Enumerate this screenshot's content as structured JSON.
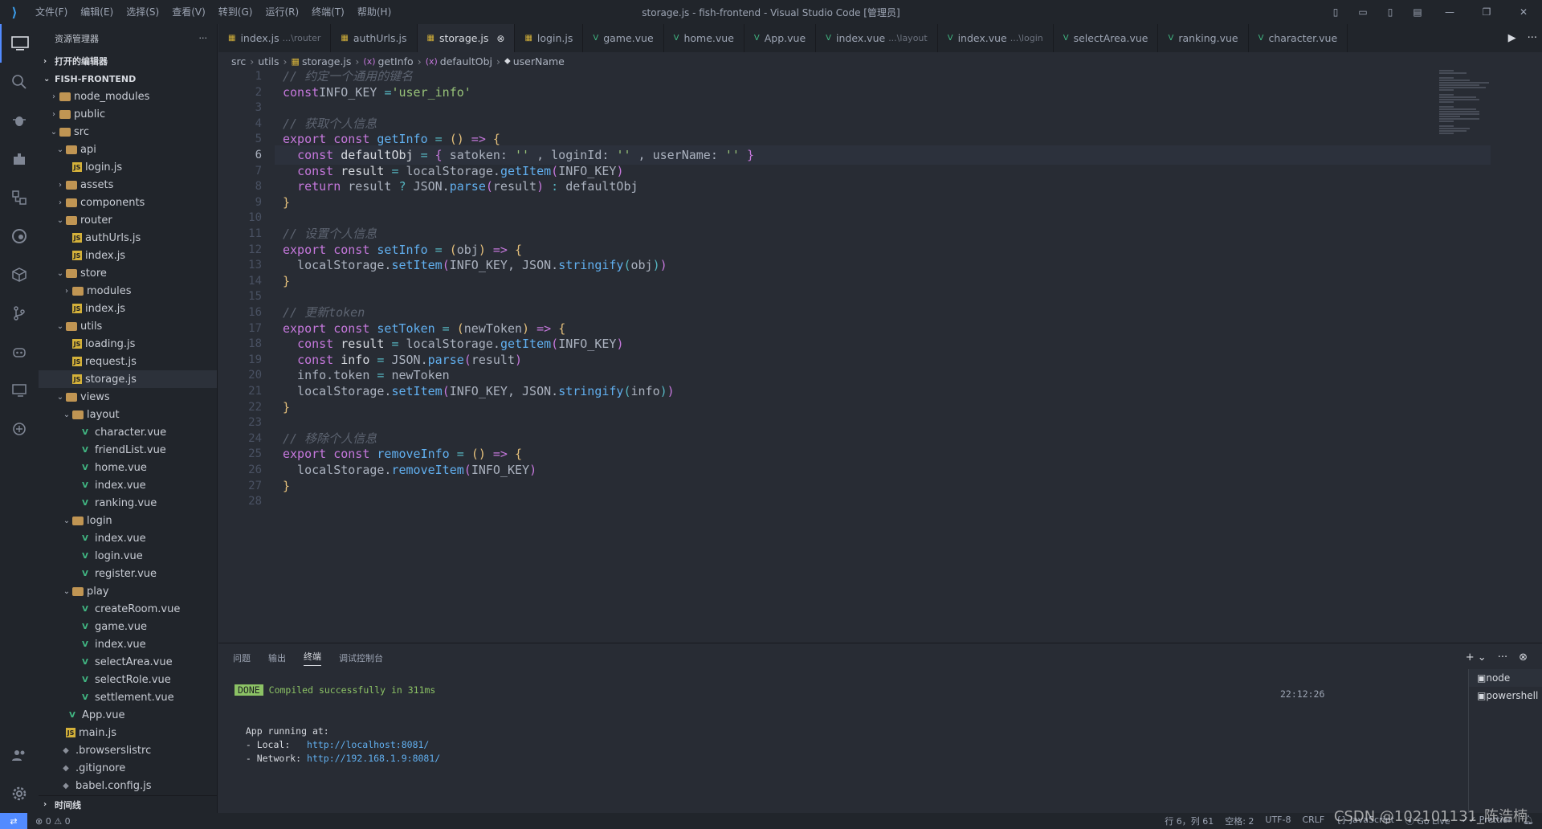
{
  "window": {
    "title": "storage.js - fish-frontend - Visual Studio Code [管理员]",
    "menu": [
      "文件(F)",
      "编辑(E)",
      "选择(S)",
      "查看(V)",
      "转到(G)",
      "运行(R)",
      "终端(T)",
      "帮助(H)"
    ]
  },
  "sidebar": {
    "title": "资源管理器",
    "open_editors": "打开的编辑器",
    "project": "FISH-FRONTEND",
    "timeline": "时间线",
    "tree": [
      {
        "depth": 1,
        "chev": "›",
        "icon": "folder",
        "label": "node_modules"
      },
      {
        "depth": 1,
        "chev": "›",
        "icon": "folder",
        "label": "public"
      },
      {
        "depth": 1,
        "chev": "⌄",
        "icon": "folder",
        "label": "src"
      },
      {
        "depth": 2,
        "chev": "⌄",
        "icon": "folder",
        "label": "api"
      },
      {
        "depth": 3,
        "chev": "",
        "icon": "js",
        "label": "login.js"
      },
      {
        "depth": 2,
        "chev": "›",
        "icon": "folder",
        "label": "assets"
      },
      {
        "depth": 2,
        "chev": "›",
        "icon": "folder",
        "label": "components"
      },
      {
        "depth": 2,
        "chev": "⌄",
        "icon": "folder",
        "label": "router"
      },
      {
        "depth": 3,
        "chev": "",
        "icon": "js",
        "label": "authUrls.js"
      },
      {
        "depth": 3,
        "chev": "",
        "icon": "js",
        "label": "index.js"
      },
      {
        "depth": 2,
        "chev": "⌄",
        "icon": "folder",
        "label": "store"
      },
      {
        "depth": 3,
        "chev": "›",
        "icon": "folder",
        "label": "modules"
      },
      {
        "depth": 3,
        "chev": "",
        "icon": "js",
        "label": "index.js"
      },
      {
        "depth": 2,
        "chev": "⌄",
        "icon": "folder",
        "label": "utils"
      },
      {
        "depth": 3,
        "chev": "",
        "icon": "js",
        "label": "loading.js"
      },
      {
        "depth": 3,
        "chev": "",
        "icon": "js",
        "label": "request.js"
      },
      {
        "depth": 3,
        "chev": "",
        "icon": "js",
        "label": "storage.js",
        "selected": true
      },
      {
        "depth": 2,
        "chev": "⌄",
        "icon": "folder",
        "label": "views"
      },
      {
        "depth": 3,
        "chev": "⌄",
        "icon": "folder",
        "label": "layout"
      },
      {
        "depth": 4,
        "chev": "",
        "icon": "vue",
        "label": "character.vue"
      },
      {
        "depth": 4,
        "chev": "",
        "icon": "vue",
        "label": "friendList.vue"
      },
      {
        "depth": 4,
        "chev": "",
        "icon": "vue",
        "label": "home.vue"
      },
      {
        "depth": 4,
        "chev": "",
        "icon": "vue",
        "label": "index.vue"
      },
      {
        "depth": 4,
        "chev": "",
        "icon": "vue",
        "label": "ranking.vue"
      },
      {
        "depth": 3,
        "chev": "⌄",
        "icon": "folder",
        "label": "login"
      },
      {
        "depth": 4,
        "chev": "",
        "icon": "vue",
        "label": "index.vue"
      },
      {
        "depth": 4,
        "chev": "",
        "icon": "vue",
        "label": "login.vue"
      },
      {
        "depth": 4,
        "chev": "",
        "icon": "vue",
        "label": "register.vue"
      },
      {
        "depth": 3,
        "chev": "⌄",
        "icon": "folder",
        "label": "play"
      },
      {
        "depth": 4,
        "chev": "",
        "icon": "vue",
        "label": "createRoom.vue"
      },
      {
        "depth": 4,
        "chev": "",
        "icon": "vue",
        "label": "game.vue"
      },
      {
        "depth": 4,
        "chev": "",
        "icon": "vue",
        "label": "index.vue"
      },
      {
        "depth": 4,
        "chev": "",
        "icon": "vue",
        "label": "selectArea.vue"
      },
      {
        "depth": 4,
        "chev": "",
        "icon": "vue",
        "label": "selectRole.vue"
      },
      {
        "depth": 4,
        "chev": "",
        "icon": "vue",
        "label": "settlement.vue"
      },
      {
        "depth": 2,
        "chev": "",
        "icon": "vue",
        "label": "App.vue"
      },
      {
        "depth": 2,
        "chev": "",
        "icon": "js",
        "label": "main.js"
      },
      {
        "depth": 1,
        "chev": "",
        "icon": "file",
        "label": ".browserslistrc"
      },
      {
        "depth": 1,
        "chev": "",
        "icon": "file",
        "label": ".gitignore"
      },
      {
        "depth": 1,
        "chev": "",
        "icon": "file",
        "label": "babel.config.js"
      }
    ]
  },
  "tabs": [
    {
      "label": "index.js",
      "hint": "...\\router",
      "icon": "js"
    },
    {
      "label": "authUrls.js",
      "hint": "",
      "icon": "js"
    },
    {
      "label": "storage.js",
      "hint": "",
      "icon": "js",
      "active": true
    },
    {
      "label": "login.js",
      "hint": "",
      "icon": "js"
    },
    {
      "label": "game.vue",
      "hint": "",
      "icon": "vue"
    },
    {
      "label": "home.vue",
      "hint": "",
      "icon": "vue"
    },
    {
      "label": "App.vue",
      "hint": "",
      "icon": "vue"
    },
    {
      "label": "index.vue",
      "hint": "...\\layout",
      "icon": "vue"
    },
    {
      "label": "index.vue",
      "hint": "...\\login",
      "icon": "vue"
    },
    {
      "label": "selectArea.vue",
      "hint": "",
      "icon": "vue"
    },
    {
      "label": "ranking.vue",
      "hint": "",
      "icon": "vue"
    },
    {
      "label": "character.vue",
      "hint": "",
      "icon": "vue"
    }
  ],
  "breadcrumb": [
    "src",
    "utils",
    "storage.js",
    "getInfo",
    "defaultObj",
    "userName"
  ],
  "editor": {
    "current_line": 6,
    "lines": [
      [
        [
          "c-com",
          "// 约定一个通用的键名"
        ]
      ],
      [
        [
          "c-kw",
          "const"
        ],
        [
          "",
          "INFO_KEY "
        ],
        [
          "c-op",
          "="
        ],
        [
          "",
          ""
        ],
        [
          "c-str",
          "'user_info'"
        ]
      ],
      [],
      [
        [
          "c-com",
          "// 获取个人信息"
        ]
      ],
      [
        [
          "c-kw",
          "export const "
        ],
        [
          "c-fn",
          "getInfo"
        ],
        [
          "c-op",
          " = "
        ],
        [
          "c-p1",
          "()"
        ],
        [
          "c-kw",
          " => "
        ],
        [
          "c-p1",
          "{"
        ]
      ],
      [
        [
          "",
          "  "
        ],
        [
          "c-kw",
          "const "
        ],
        [
          "c-def",
          "defaultObj "
        ],
        [
          "c-op",
          "= "
        ],
        [
          "c-p2",
          "{ "
        ],
        [
          "",
          "satoken: "
        ],
        [
          "c-str",
          "''"
        ],
        [
          "",
          " , loginId: "
        ],
        [
          "c-str",
          "''"
        ],
        [
          "",
          " , userName: "
        ],
        [
          "c-str",
          "'' "
        ],
        [
          "c-p2",
          "}"
        ]
      ],
      [
        [
          "",
          "  "
        ],
        [
          "c-kw",
          "const "
        ],
        [
          "c-def",
          "result "
        ],
        [
          "c-op",
          "= "
        ],
        [
          "",
          "localStorage."
        ],
        [
          "c-fn",
          "getItem"
        ],
        [
          "c-p2",
          "("
        ],
        [
          "",
          "INFO_KEY"
        ],
        [
          "c-p2",
          ")"
        ]
      ],
      [
        [
          "",
          "  "
        ],
        [
          "c-kw",
          "return "
        ],
        [
          "",
          "result "
        ],
        [
          "c-op",
          "? "
        ],
        [
          "",
          "JSON."
        ],
        [
          "c-fn",
          "parse"
        ],
        [
          "c-p2",
          "("
        ],
        [
          "",
          "result"
        ],
        [
          "c-p2",
          ")"
        ],
        [
          "c-op",
          " : "
        ],
        [
          "",
          "defaultObj"
        ]
      ],
      [
        [
          "c-p1",
          "}"
        ]
      ],
      [],
      [
        [
          "c-com",
          "// 设置个人信息"
        ]
      ],
      [
        [
          "c-kw",
          "export const "
        ],
        [
          "c-fn",
          "setInfo"
        ],
        [
          "c-op",
          " = "
        ],
        [
          "c-p1",
          "("
        ],
        [
          "",
          "obj"
        ],
        [
          "c-p1",
          ")"
        ],
        [
          "c-kw",
          " => "
        ],
        [
          "c-p1",
          "{"
        ]
      ],
      [
        [
          "",
          "  localStorage."
        ],
        [
          "c-fn",
          "setItem"
        ],
        [
          "c-p2",
          "("
        ],
        [
          "",
          "INFO_KEY, JSON."
        ],
        [
          "c-fn",
          "stringify"
        ],
        [
          "c-op",
          "("
        ],
        [
          "",
          "obj"
        ],
        [
          "c-op",
          ")"
        ],
        [
          "c-p2",
          ")"
        ]
      ],
      [
        [
          "c-p1",
          "}"
        ]
      ],
      [],
      [
        [
          "c-com",
          "// 更新token"
        ]
      ],
      [
        [
          "c-kw",
          "export const "
        ],
        [
          "c-fn",
          "setToken"
        ],
        [
          "c-op",
          " = "
        ],
        [
          "c-p1",
          "("
        ],
        [
          "",
          "newToken"
        ],
        [
          "c-p1",
          ")"
        ],
        [
          "c-kw",
          " => "
        ],
        [
          "c-p1",
          "{"
        ]
      ],
      [
        [
          "",
          "  "
        ],
        [
          "c-kw",
          "const "
        ],
        [
          "c-def",
          "result "
        ],
        [
          "c-op",
          "= "
        ],
        [
          "",
          "localStorage."
        ],
        [
          "c-fn",
          "getItem"
        ],
        [
          "c-p2",
          "("
        ],
        [
          "",
          "INFO_KEY"
        ],
        [
          "c-p2",
          ")"
        ]
      ],
      [
        [
          "",
          "  "
        ],
        [
          "c-kw",
          "const "
        ],
        [
          "c-def",
          "info "
        ],
        [
          "c-op",
          "= "
        ],
        [
          "",
          "JSON."
        ],
        [
          "c-fn",
          "parse"
        ],
        [
          "c-p2",
          "("
        ],
        [
          "",
          "result"
        ],
        [
          "c-p2",
          ")"
        ]
      ],
      [
        [
          "",
          "  info.token "
        ],
        [
          "c-op",
          "= "
        ],
        [
          "",
          "newToken"
        ]
      ],
      [
        [
          "",
          "  localStorage."
        ],
        [
          "c-fn",
          "setItem"
        ],
        [
          "c-p2",
          "("
        ],
        [
          "",
          "INFO_KEY, JSON."
        ],
        [
          "c-fn",
          "stringify"
        ],
        [
          "c-op",
          "("
        ],
        [
          "",
          "info"
        ],
        [
          "c-op",
          ")"
        ],
        [
          "c-p2",
          ")"
        ]
      ],
      [
        [
          "c-p1",
          "}"
        ]
      ],
      [],
      [
        [
          "c-com",
          "// 移除个人信息"
        ]
      ],
      [
        [
          "c-kw",
          "export const "
        ],
        [
          "c-fn",
          "removeInfo"
        ],
        [
          "c-op",
          " = "
        ],
        [
          "c-p1",
          "()"
        ],
        [
          "c-kw",
          " => "
        ],
        [
          "c-p1",
          "{"
        ]
      ],
      [
        [
          "",
          "  localStorage."
        ],
        [
          "c-fn",
          "removeItem"
        ],
        [
          "c-p2",
          "("
        ],
        [
          "",
          "INFO_KEY"
        ],
        [
          "c-p2",
          ")"
        ]
      ],
      [
        [
          "c-p1",
          "}"
        ]
      ],
      []
    ]
  },
  "panel": {
    "tabs": [
      "问题",
      "输出",
      "终端",
      "调试控制台"
    ],
    "active_tab": "终端",
    "done_badge": "DONE",
    "compiled": "Compiled successfully in 311ms",
    "time": "22:12:26",
    "running": "App running at:",
    "local_label": "- Local:   ",
    "local_url": "http://localhost:8081/",
    "network_label": "- Network: ",
    "network_url": "http://192.168.1.9:8081/",
    "terminals": [
      "node",
      "powershell"
    ]
  },
  "statusbar": {
    "errors": "0",
    "warnings": "0",
    "position": "行 6，列 61",
    "spaces": "空格: 2",
    "encoding": "UTF-8",
    "eol": "CRLF",
    "language": "JavaScript",
    "golive": "Go Live",
    "prettier": "Prettier"
  },
  "watermark": "CSDN @102101131_陈浩楠"
}
